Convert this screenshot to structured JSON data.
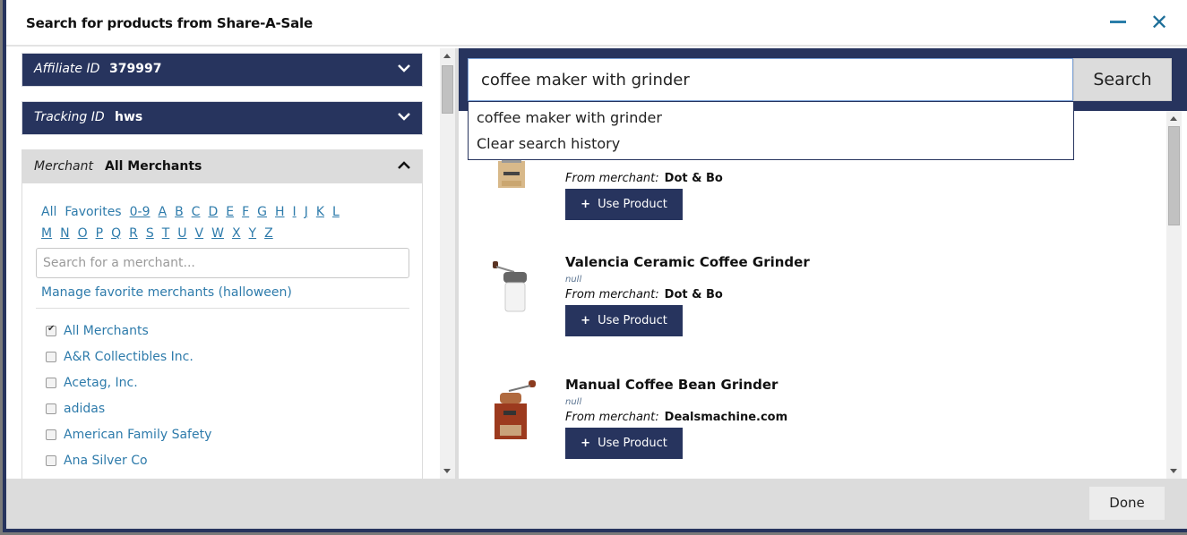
{
  "dialog": {
    "title": "Search for products from Share-A-Sale",
    "minimize_icon": "minimize-icon",
    "close_icon": "close-icon"
  },
  "sidebar": {
    "affiliate": {
      "label": "Affiliate ID",
      "value": "379997",
      "icon": "chevron-down-icon"
    },
    "tracking": {
      "label": "Tracking ID",
      "value": "hws",
      "icon": "chevron-down-icon"
    },
    "merchant": {
      "label": "Merchant",
      "value": "All Merchants",
      "icon": "chevron-up-icon",
      "alpha_row1": [
        "All",
        "Favorites",
        "0-9",
        "A",
        "B",
        "C",
        "D",
        "E",
        "F",
        "G",
        "H",
        "I",
        "J",
        "K",
        "L"
      ],
      "alpha_row2": [
        "M",
        "N",
        "O",
        "P",
        "Q",
        "R",
        "S",
        "T",
        "U",
        "V",
        "W",
        "X",
        "Y",
        "Z"
      ],
      "search_placeholder": "Search for a merchant...",
      "manage_favorites": "Manage favorite merchants (halloween)",
      "list": [
        {
          "name": "All Merchants",
          "checked": true
        },
        {
          "name": "A&R Collectibles Inc.",
          "checked": false
        },
        {
          "name": "Acetag, Inc.",
          "checked": false
        },
        {
          "name": "adidas",
          "checked": false
        },
        {
          "name": "American Family Safety",
          "checked": false
        },
        {
          "name": "Ana Silver Co",
          "checked": false
        }
      ]
    }
  },
  "search": {
    "query": "coffee maker with grinder",
    "button_label": "Search",
    "suggestions": [
      "coffee maker with grinder",
      "Clear search history"
    ]
  },
  "results": {
    "from_label": "From merchant:",
    "use_label": "Use Product",
    "items": [
      {
        "title": "",
        "desc": "",
        "merchant": "Dot & Bo",
        "image": "wooden-coffee-grinder-image"
      },
      {
        "title": "Valencia Ceramic Coffee Grinder",
        "desc": "null",
        "merchant": "Dot & Bo",
        "image": "ceramic-coffee-grinder-image"
      },
      {
        "title": "Manual Coffee Bean Grinder",
        "desc": "null",
        "merchant": "Dealsmachine.com",
        "image": "manual-coffee-grinder-image"
      }
    ]
  },
  "footer": {
    "done_label": "Done"
  }
}
